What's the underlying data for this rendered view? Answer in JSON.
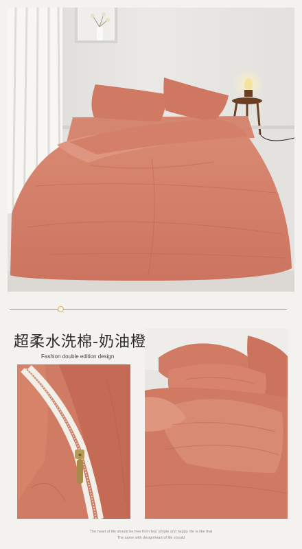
{
  "product": {
    "title": "超柔水洗棉-奶油橙",
    "subtitle": "Fashion double edition design"
  },
  "footer": {
    "line1": "The heart of life should be free from fear simple and happy. life is like that",
    "line2": "The same with designheart of life should"
  },
  "colors": {
    "accent": "#d4a84a",
    "divider": "#8a8fb8",
    "bedding": "#d57c66",
    "background": "#f4f2ef"
  }
}
